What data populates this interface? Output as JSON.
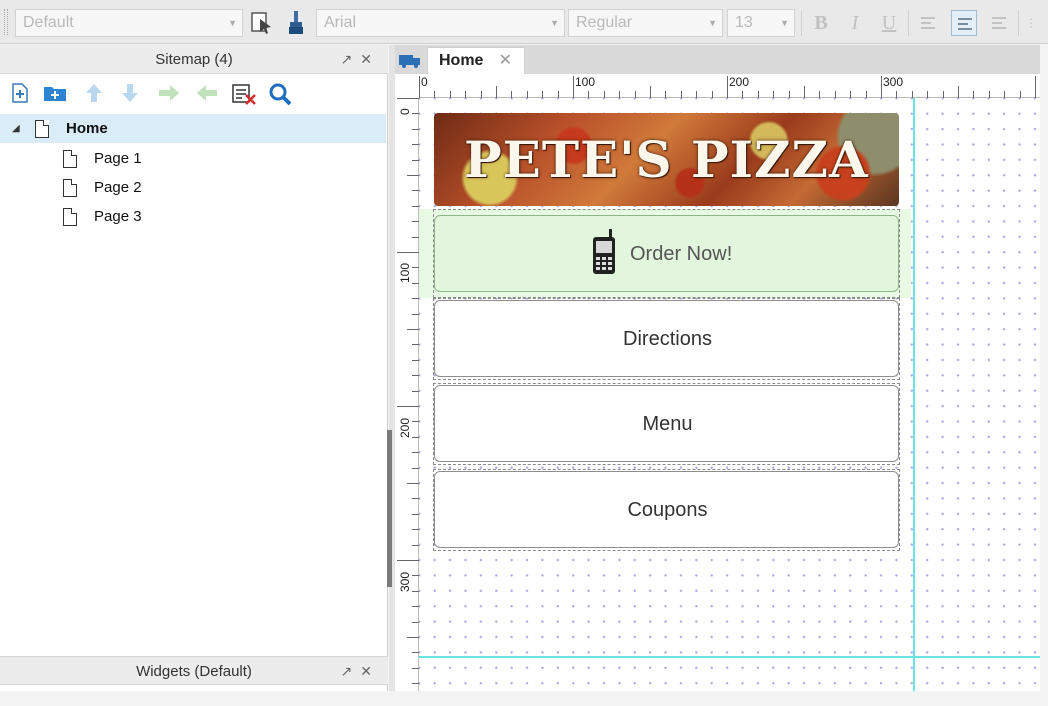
{
  "toolbar": {
    "style_combo": "Default",
    "font_combo": "Arial",
    "weight_combo": "Regular",
    "size_combo": "13",
    "bold_label": "B",
    "italic_label": "I",
    "underline_label": "U"
  },
  "sitemap": {
    "title": "Sitemap (4)",
    "pages": [
      {
        "label": "Home",
        "selected": true
      },
      {
        "label": "Page 1"
      },
      {
        "label": "Page 2"
      },
      {
        "label": "Page 3"
      }
    ]
  },
  "widgets_panel": {
    "title": "Widgets (Default)"
  },
  "canvas": {
    "tab_label": "Home",
    "ruler_top": [
      "0",
      "100",
      "200",
      "300"
    ],
    "ruler_left": [
      "0",
      "100",
      "200",
      "300"
    ],
    "banner_text": "PETE'S PIZZA",
    "buttons": {
      "order": "Order Now!",
      "directions": "Directions",
      "menu": "Menu",
      "coupons": "Coupons"
    }
  },
  "colors": {
    "selection": "#d9ecf8",
    "guide": "#69e3e3",
    "order_button_bg": "#e1f6dc",
    "grid_dot": "#a8a8e0"
  },
  "icons": [
    "new-page-icon",
    "new-folder-icon",
    "move-up-icon",
    "move-down-icon",
    "indent-icon",
    "outdent-icon",
    "delete-page-icon",
    "search-icon",
    "format-painter-icon",
    "brush-icon",
    "mobile-phone-icon",
    "page-icon"
  ]
}
